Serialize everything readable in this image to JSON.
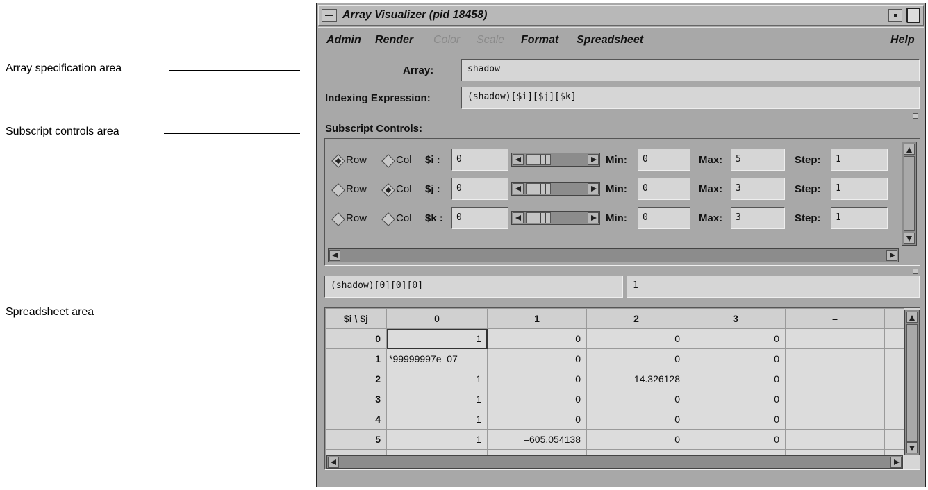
{
  "callouts": {
    "array_spec": "Array specification area",
    "subscript_controls": "Subscript controls area",
    "spreadsheet": "Spreadsheet area"
  },
  "window": {
    "title": "Array Visualizer (pid 18458)"
  },
  "menubar": {
    "admin": "Admin",
    "render": "Render",
    "color": "Color",
    "scale": "Scale",
    "format": "Format",
    "spreadsheet": "Spreadsheet",
    "help": "Help"
  },
  "array_spec": {
    "array_label": "Array:",
    "array_value": "shadow",
    "indexing_label": "Indexing Expression:",
    "indexing_value": "(shadow)[$i][$j][$k]"
  },
  "subscript_controls": {
    "title": "Subscript Controls:",
    "row_label": "Row",
    "col_label": "Col",
    "min_label": "Min:",
    "max_label": "Max:",
    "step_label": "Step:",
    "rows": [
      {
        "var": "$i :",
        "value": "0",
        "min": "0",
        "max": "5",
        "step": "1",
        "mode": "row"
      },
      {
        "var": "$j :",
        "value": "0",
        "min": "0",
        "max": "3",
        "step": "1",
        "mode": "col"
      },
      {
        "var": "$k :",
        "value": "0",
        "min": "0",
        "max": "3",
        "step": "1",
        "mode": "none"
      }
    ]
  },
  "cell_editor": {
    "expression": "(shadow)[0][0][0]",
    "value": "1"
  },
  "spreadsheet": {
    "corner": "$i \\ $j",
    "columns": [
      "0",
      "1",
      "2",
      "3",
      "–"
    ],
    "rows": [
      {
        "label": "0",
        "cells": [
          "1",
          "0",
          "0",
          "0",
          ""
        ]
      },
      {
        "label": "1",
        "cells": [
          "*99999997e–07",
          "0",
          "0",
          "0",
          ""
        ]
      },
      {
        "label": "2",
        "cells": [
          "1",
          "0",
          "–14.326128",
          "0",
          ""
        ]
      },
      {
        "label": "3",
        "cells": [
          "1",
          "0",
          "0",
          "0",
          ""
        ]
      },
      {
        "label": "4",
        "cells": [
          "1",
          "0",
          "0",
          "0",
          ""
        ]
      },
      {
        "label": "5",
        "cells": [
          "1",
          "–605.054138",
          "0",
          "0",
          ""
        ]
      }
    ]
  }
}
